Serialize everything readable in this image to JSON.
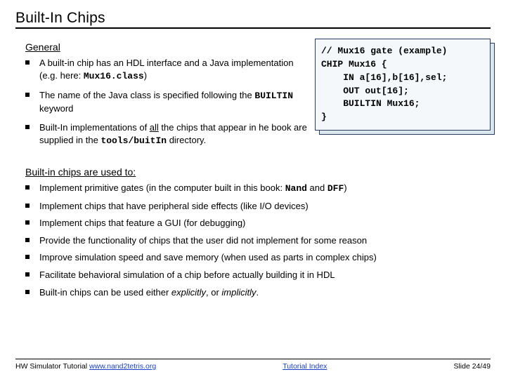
{
  "title": "Built-In Chips",
  "section_general": "General",
  "general_items": [
    {
      "pre": "A built-in chip has an HDL interface and a Java implementation (e.g. here: ",
      "code": "Mux16.class",
      "post": ")"
    },
    {
      "pre": "The name of the Java class is specified following the ",
      "code": "BUILTIN",
      "post": " keyword"
    },
    {
      "pre": "Built-In implementations of ",
      "u": "all",
      "mid": " the chips that appear in he book are supplied in the ",
      "code": "tools/buitIn",
      "post": " directory."
    }
  ],
  "codebox": "// Mux16 gate (example)\nCHIP Mux16 {\n    IN a[16],b[16],sel;\n    OUT out[16];\n    BUILTIN Mux16;\n}",
  "section_used": "Built-in chips are used to:",
  "used_items": [
    {
      "pre": "Implement primitive gates (in the computer built in this book: ",
      "code1": "Nand",
      "mid": " and ",
      "code2": "DFF",
      "post": ")"
    },
    {
      "text": "Implement chips that have peripheral side effects (like I/O devices)"
    },
    {
      "text": "Implement chips that feature a GUI (for debugging)"
    },
    {
      "text": "Provide the functionality of chips that the user did not implement for some reason"
    },
    {
      "text": "Improve simulation speed and save memory (when used as parts in complex chips)"
    },
    {
      "text": "Facilitate behavioral simulation of a chip before actually building it in HDL"
    },
    {
      "pre": "Built-in chips can be used either ",
      "it1": "explicitly",
      "mid": ", or ",
      "it2": "implicitly",
      "post": "."
    }
  ],
  "footer": {
    "left_pre": "HW Simulator Tutorial ",
    "left_link": "www.nand2tetris.org",
    "center": "Tutorial Index",
    "right": "Slide 24/49"
  }
}
